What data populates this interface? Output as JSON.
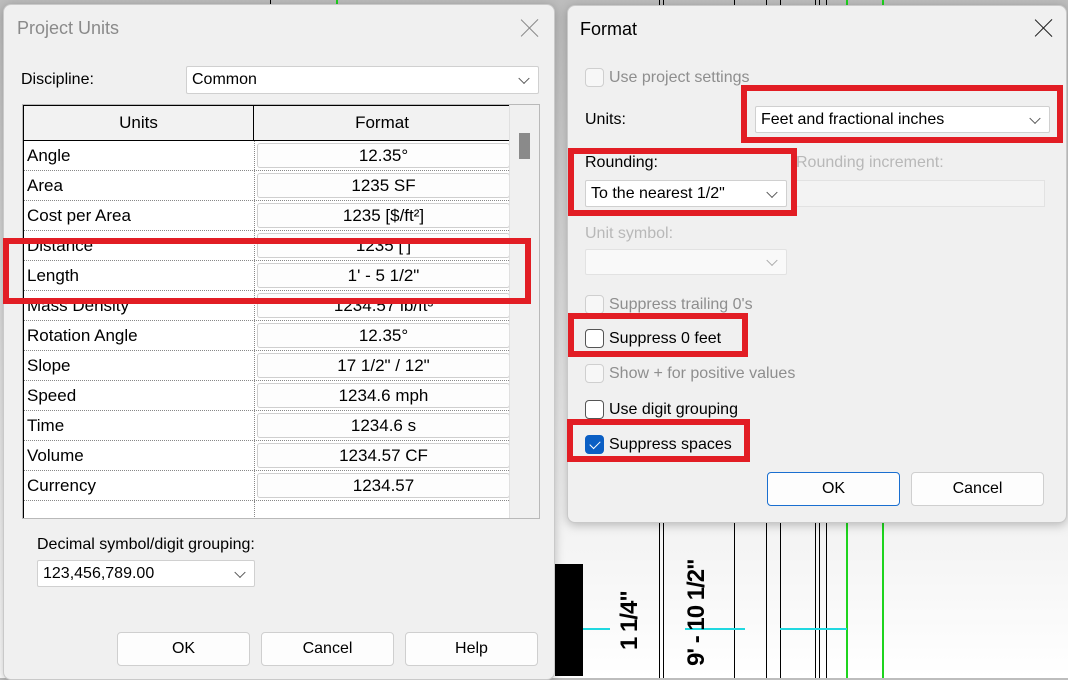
{
  "background": {
    "dimension_labels": [
      "1 1/4\"",
      "9' - 10 1/2\""
    ]
  },
  "project_units": {
    "title": "Project Units",
    "discipline_label": "Discipline:",
    "discipline_value": "Common",
    "table": {
      "headers": [
        "Units",
        "Format"
      ],
      "rows": [
        {
          "unit": "Angle",
          "format": "12.35°"
        },
        {
          "unit": "Area",
          "format": "1235 SF"
        },
        {
          "unit": "Cost per Area",
          "format": "1235 [$/ft²]"
        },
        {
          "unit": "Distance",
          "format": "1235 [']"
        },
        {
          "unit": "Length",
          "format": "1' - 5 1/2\""
        },
        {
          "unit": "Mass Density",
          "format": "1234.57 lb/ft³"
        },
        {
          "unit": "Rotation Angle",
          "format": "12.35°"
        },
        {
          "unit": "Slope",
          "format": "17 1/2\" / 12\""
        },
        {
          "unit": "Speed",
          "format": "1234.6 mph"
        },
        {
          "unit": "Time",
          "format": "1234.6 s"
        },
        {
          "unit": "Volume",
          "format": "1234.57 CF"
        },
        {
          "unit": "Currency",
          "format": "1234.57"
        }
      ]
    },
    "decimal_label": "Decimal symbol/digit grouping:",
    "decimal_value": "123,456,789.00",
    "buttons": {
      "ok": "OK",
      "cancel": "Cancel",
      "help": "Help"
    }
  },
  "format_dialog": {
    "title": "Format",
    "use_project_settings": {
      "label": "Use project settings",
      "checked": false,
      "enabled": false
    },
    "units_label": "Units:",
    "units_value": "Feet and fractional inches",
    "rounding_label": "Rounding:",
    "rounding_value": "To the nearest 1/2\"",
    "rounding_increment_label": "Rounding increment:",
    "rounding_increment_value": "",
    "unit_symbol_label": "Unit symbol:",
    "unit_symbol_value": "",
    "checkboxes": [
      {
        "label": "Suppress trailing 0's",
        "checked": false,
        "enabled": false
      },
      {
        "label": "Suppress 0 feet",
        "checked": false,
        "enabled": true
      },
      {
        "label": "Show + for positive values",
        "checked": false,
        "enabled": false
      },
      {
        "label": "Use digit grouping",
        "checked": false,
        "enabled": true
      },
      {
        "label": "Suppress spaces",
        "checked": true,
        "enabled": true
      }
    ],
    "buttons": {
      "ok": "OK",
      "cancel": "Cancel"
    }
  },
  "annotation_color": "#e21d24"
}
